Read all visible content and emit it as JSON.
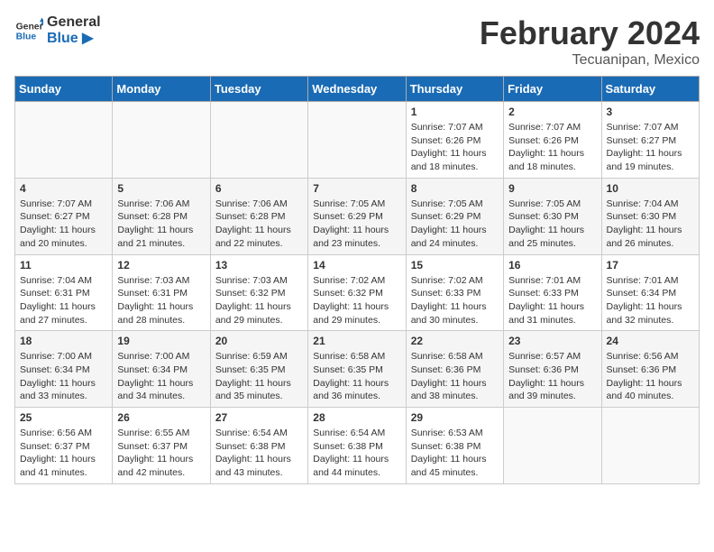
{
  "header": {
    "logo_general": "General",
    "logo_blue": "Blue",
    "month_year": "February 2024",
    "location": "Tecuanipan, Mexico"
  },
  "days_of_week": [
    "Sunday",
    "Monday",
    "Tuesday",
    "Wednesday",
    "Thursday",
    "Friday",
    "Saturday"
  ],
  "weeks": [
    [
      {
        "day": "",
        "info": ""
      },
      {
        "day": "",
        "info": ""
      },
      {
        "day": "",
        "info": ""
      },
      {
        "day": "",
        "info": ""
      },
      {
        "day": "1",
        "info": "Sunrise: 7:07 AM\nSunset: 6:26 PM\nDaylight: 11 hours\nand 18 minutes."
      },
      {
        "day": "2",
        "info": "Sunrise: 7:07 AM\nSunset: 6:26 PM\nDaylight: 11 hours\nand 18 minutes."
      },
      {
        "day": "3",
        "info": "Sunrise: 7:07 AM\nSunset: 6:27 PM\nDaylight: 11 hours\nand 19 minutes."
      }
    ],
    [
      {
        "day": "4",
        "info": "Sunrise: 7:07 AM\nSunset: 6:27 PM\nDaylight: 11 hours\nand 20 minutes."
      },
      {
        "day": "5",
        "info": "Sunrise: 7:06 AM\nSunset: 6:28 PM\nDaylight: 11 hours\nand 21 minutes."
      },
      {
        "day": "6",
        "info": "Sunrise: 7:06 AM\nSunset: 6:28 PM\nDaylight: 11 hours\nand 22 minutes."
      },
      {
        "day": "7",
        "info": "Sunrise: 7:05 AM\nSunset: 6:29 PM\nDaylight: 11 hours\nand 23 minutes."
      },
      {
        "day": "8",
        "info": "Sunrise: 7:05 AM\nSunset: 6:29 PM\nDaylight: 11 hours\nand 24 minutes."
      },
      {
        "day": "9",
        "info": "Sunrise: 7:05 AM\nSunset: 6:30 PM\nDaylight: 11 hours\nand 25 minutes."
      },
      {
        "day": "10",
        "info": "Sunrise: 7:04 AM\nSunset: 6:30 PM\nDaylight: 11 hours\nand 26 minutes."
      }
    ],
    [
      {
        "day": "11",
        "info": "Sunrise: 7:04 AM\nSunset: 6:31 PM\nDaylight: 11 hours\nand 27 minutes."
      },
      {
        "day": "12",
        "info": "Sunrise: 7:03 AM\nSunset: 6:31 PM\nDaylight: 11 hours\nand 28 minutes."
      },
      {
        "day": "13",
        "info": "Sunrise: 7:03 AM\nSunset: 6:32 PM\nDaylight: 11 hours\nand 29 minutes."
      },
      {
        "day": "14",
        "info": "Sunrise: 7:02 AM\nSunset: 6:32 PM\nDaylight: 11 hours\nand 29 minutes."
      },
      {
        "day": "15",
        "info": "Sunrise: 7:02 AM\nSunset: 6:33 PM\nDaylight: 11 hours\nand 30 minutes."
      },
      {
        "day": "16",
        "info": "Sunrise: 7:01 AM\nSunset: 6:33 PM\nDaylight: 11 hours\nand 31 minutes."
      },
      {
        "day": "17",
        "info": "Sunrise: 7:01 AM\nSunset: 6:34 PM\nDaylight: 11 hours\nand 32 minutes."
      }
    ],
    [
      {
        "day": "18",
        "info": "Sunrise: 7:00 AM\nSunset: 6:34 PM\nDaylight: 11 hours\nand 33 minutes."
      },
      {
        "day": "19",
        "info": "Sunrise: 7:00 AM\nSunset: 6:34 PM\nDaylight: 11 hours\nand 34 minutes."
      },
      {
        "day": "20",
        "info": "Sunrise: 6:59 AM\nSunset: 6:35 PM\nDaylight: 11 hours\nand 35 minutes."
      },
      {
        "day": "21",
        "info": "Sunrise: 6:58 AM\nSunset: 6:35 PM\nDaylight: 11 hours\nand 36 minutes."
      },
      {
        "day": "22",
        "info": "Sunrise: 6:58 AM\nSunset: 6:36 PM\nDaylight: 11 hours\nand 38 minutes."
      },
      {
        "day": "23",
        "info": "Sunrise: 6:57 AM\nSunset: 6:36 PM\nDaylight: 11 hours\nand 39 minutes."
      },
      {
        "day": "24",
        "info": "Sunrise: 6:56 AM\nSunset: 6:36 PM\nDaylight: 11 hours\nand 40 minutes."
      }
    ],
    [
      {
        "day": "25",
        "info": "Sunrise: 6:56 AM\nSunset: 6:37 PM\nDaylight: 11 hours\nand 41 minutes."
      },
      {
        "day": "26",
        "info": "Sunrise: 6:55 AM\nSunset: 6:37 PM\nDaylight: 11 hours\nand 42 minutes."
      },
      {
        "day": "27",
        "info": "Sunrise: 6:54 AM\nSunset: 6:38 PM\nDaylight: 11 hours\nand 43 minutes."
      },
      {
        "day": "28",
        "info": "Sunrise: 6:54 AM\nSunset: 6:38 PM\nDaylight: 11 hours\nand 44 minutes."
      },
      {
        "day": "29",
        "info": "Sunrise: 6:53 AM\nSunset: 6:38 PM\nDaylight: 11 hours\nand 45 minutes."
      },
      {
        "day": "",
        "info": ""
      },
      {
        "day": "",
        "info": ""
      }
    ]
  ]
}
